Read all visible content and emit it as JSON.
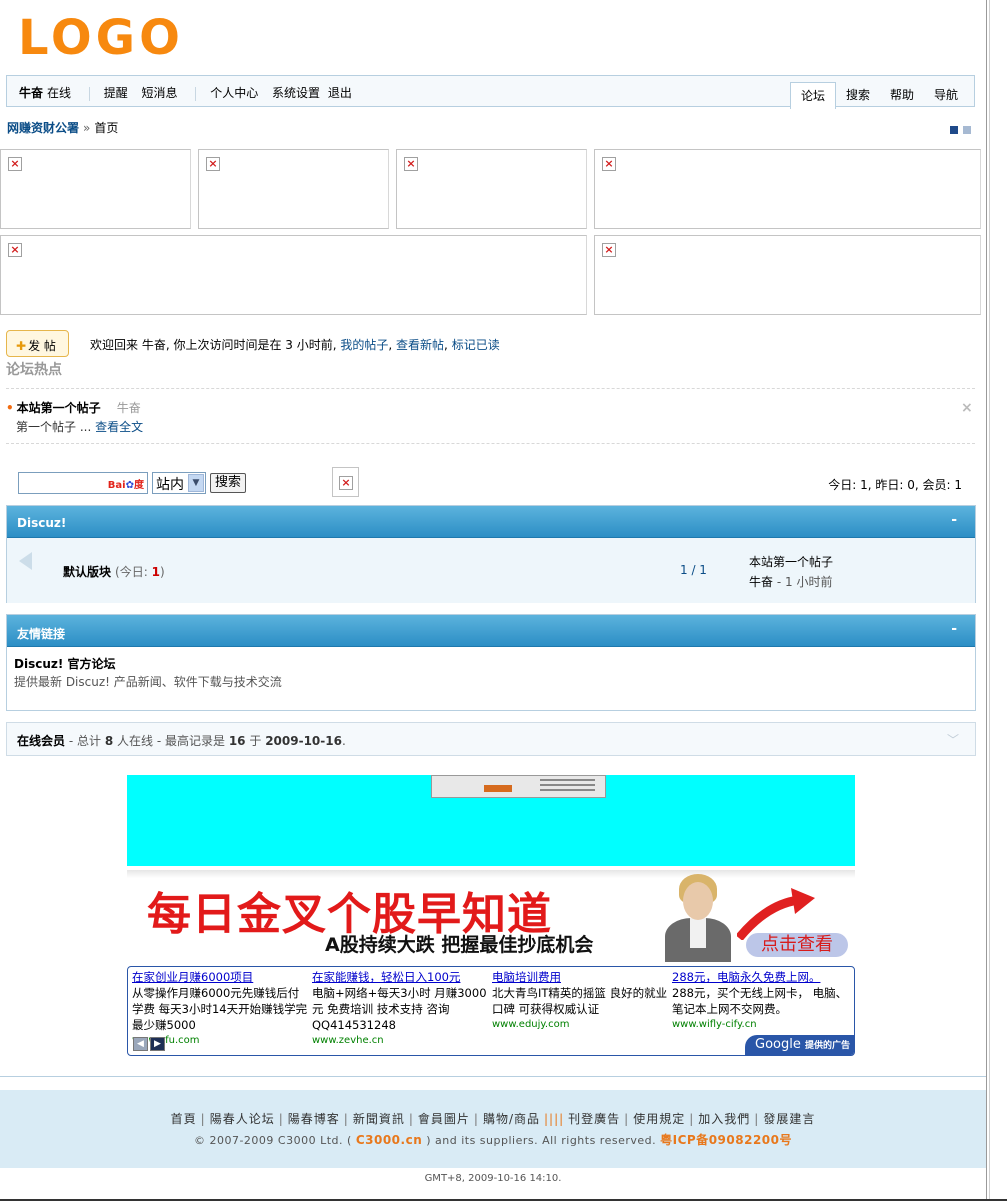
{
  "logo": "LOGO",
  "user": {
    "name": "牛奋",
    "status": "在线",
    "nav_items": [
      "提醒",
      "短消息",
      "个人中心",
      "系统设置",
      "退出"
    ]
  },
  "tabs": [
    "论坛",
    "搜索",
    "帮助",
    "导航"
  ],
  "active_tab": "论坛",
  "breadcrumb": {
    "site": "网赚资财公署",
    "separator": "»",
    "current": "首页"
  },
  "post_button": "发 帖",
  "welcome": {
    "text": "欢迎回来 牛奋, 你上次访问时间是在 3 小时前,",
    "my_posts": "我的帖子",
    "new_posts": "查看新帖",
    "mark_read": "标记已读",
    "comma": ","
  },
  "hot": {
    "title": "论坛热点",
    "item_title": "本站第一个帖子",
    "item_author": "牛奋",
    "excerpt": "第一个帖子 ...",
    "read_more": "查看全文"
  },
  "search": {
    "baidu_logo_a": "Bai",
    "baidu_logo_b": "度",
    "scope": "站内",
    "button": "搜索"
  },
  "stats": "今日: 1, 昨日: 0, 会员: 1",
  "category": {
    "name": "Discuz!",
    "collapse": "-",
    "forum": {
      "name": "默认版块",
      "today_label": "(今日:",
      "today_count": "1",
      "today_close": ")",
      "counts": "1 / 1",
      "last_post_title": "本站第一个帖子",
      "last_post_author": "牛奋",
      "last_post_time": "- 1 小时前"
    }
  },
  "links": {
    "title": "友情链接",
    "collapse": "-",
    "name": "Discuz! 官方论坛",
    "desc": "提供最新 Discuz! 产品新闻、软件下载与技术交流"
  },
  "online": {
    "label": "在线会员",
    "total_prefix": "- 总计",
    "total": "8",
    "total_suffix": "人在线 - 最高记录是",
    "max": "16",
    "at": "于",
    "date": "2009-10-16",
    "end": "."
  },
  "stock_ad": {
    "headline": "每日金叉个股早知道",
    "sub": "A股持续大跌  把握最佳抄底机会",
    "cta": "点击查看"
  },
  "google_ads": [
    {
      "title": "在家创业月赚6000项目",
      "desc": "从零操作月赚6000元先赚钱后付学费 每天3小时14天开始赚钱学完最少赚5000",
      "url": "www.pfu.com"
    },
    {
      "title": "在家能赚钱，轻松日入100元",
      "desc": "电脑+网络+每天3小时 月赚3000元 免费培训 技术支持 咨询QQ414531248",
      "url": "www.zevhe.cn"
    },
    {
      "title": "电脑培训费用",
      "desc": "北大青鸟IT精英的摇篮 良好的就业口碑 可获得权威认证",
      "url": "www.edujy.com"
    },
    {
      "title": "288元，电脑永久免费上网。",
      "desc": "288元，买个无线上网卡， 电脑、笔记本上网不交网费。",
      "url": "www.wifly-cify.cn"
    }
  ],
  "google_badge": {
    "brand": "Google",
    "text": "提供的广告"
  },
  "footer": {
    "links": [
      "首頁",
      "陽春人论坛",
      "陽春博客",
      "新聞資訊",
      "會員圖片",
      "購物/商品",
      "刊登廣告",
      "使用規定",
      "加入我們",
      "發展建言"
    ],
    "copyright_pre": "© 2007-2009 C3000 Ltd. (",
    "brand": "C3000.cn",
    "copyright_post": ") and its suppliers. All rights reserved.",
    "icp": "粤ICP备09082200号"
  },
  "gmt": "GMT+8, 2009-10-16 14:10."
}
